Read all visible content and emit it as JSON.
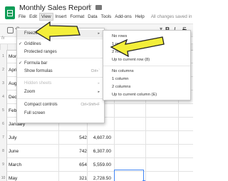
{
  "header": {
    "title": "Monthly Sales Report",
    "star_glyph": "☆"
  },
  "menubar": {
    "items": [
      "File",
      "Edit",
      "View",
      "Insert",
      "Format",
      "Data",
      "Tools",
      "Add-ons",
      "Help"
    ],
    "status": "All changes saved in Drive"
  },
  "toolbar": {
    "undo_glyph": "↶",
    "dropdown_glyph": "▾",
    "bold": "B",
    "italic": "I",
    "strike": "S"
  },
  "formula_bar": {
    "label": "fx"
  },
  "grid": {
    "columns": [
      "",
      "A",
      "B",
      "C",
      "D"
    ],
    "rows": [
      {
        "num": "1",
        "a": "Month",
        "b": "",
        "c": ""
      },
      {
        "num": "2",
        "a": "April",
        "b": "",
        "c": ""
      },
      {
        "num": "3",
        "a": "August",
        "b": "",
        "c": ""
      },
      {
        "num": "4",
        "a": "December",
        "b": "",
        "c": ""
      },
      {
        "num": "5",
        "a": "February",
        "b": "",
        "c": ""
      },
      {
        "num": "6",
        "a": "January",
        "b": "",
        "c": ""
      },
      {
        "num": "7",
        "a": "July",
        "b": "542",
        "c": "4,607.00"
      },
      {
        "num": "8",
        "a": "June",
        "b": "742",
        "c": "6,307.00"
      },
      {
        "num": "9",
        "a": "March",
        "b": "654",
        "c": "5,559.00"
      },
      {
        "num": "10",
        "a": "May",
        "b": "321",
        "c": "2,728.50"
      }
    ]
  },
  "view_menu": {
    "items": [
      {
        "label": "Freeze",
        "submenu": "▸",
        "highlighted": true
      },
      {
        "label": "Gridlines",
        "checked": true
      },
      {
        "label": "Protected ranges"
      },
      {
        "label": "Formula bar",
        "checked": true
      },
      {
        "label": "Show formulas",
        "shortcut": "Ctrl+`"
      },
      {
        "label": "Hidden sheets",
        "submenu": "▸",
        "disabled": true
      },
      {
        "label": "Zoom",
        "submenu": "▸"
      },
      {
        "label": "Compact controls",
        "shortcut": "Ctrl+Shift+F"
      },
      {
        "label": "Full screen"
      }
    ],
    "check_glyph": "✓"
  },
  "freeze_menu": {
    "items": [
      "No rows",
      "1 row",
      "2 rows",
      "Up to current row (8)",
      "No columns",
      "1 column",
      "2 columns",
      "Up to current column (E)"
    ]
  },
  "annotations": {
    "arrow_color": "#f3ee3a",
    "arrow_outline": "#222222"
  }
}
